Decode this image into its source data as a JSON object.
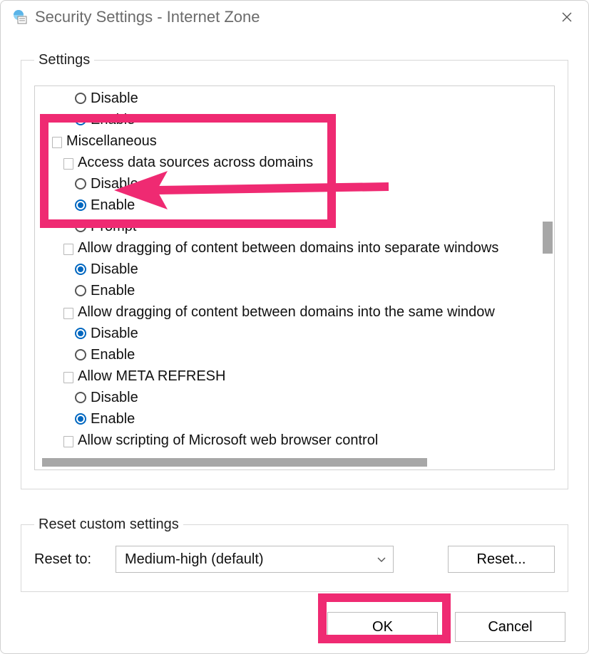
{
  "window": {
    "title": "Security Settings - Internet Zone"
  },
  "groups": {
    "settings_legend": "Settings",
    "reset_legend": "Reset custom settings"
  },
  "tree": {
    "top_disable": "Disable",
    "top_enable": "Enable",
    "misc": "Miscellaneous",
    "access": "Access data sources across domains",
    "access_disable": "Disable",
    "access_enable": "Enable",
    "access_prompt": "Prompt",
    "drag_sep": "Allow dragging of content between domains into separate windows",
    "drag_sep_disable": "Disable",
    "drag_sep_enable": "Enable",
    "drag_same": "Allow dragging of content between domains into the same window",
    "drag_same_disable": "Disable",
    "drag_same_enable": "Enable",
    "meta": "Allow META REFRESH",
    "meta_disable": "Disable",
    "meta_enable": "Enable",
    "scripting": "Allow scripting of Microsoft web browser control"
  },
  "reset": {
    "label": "Reset to:",
    "selected": "Medium-high (default)",
    "button": "Reset..."
  },
  "buttons": {
    "ok": "OK",
    "cancel": "Cancel"
  }
}
